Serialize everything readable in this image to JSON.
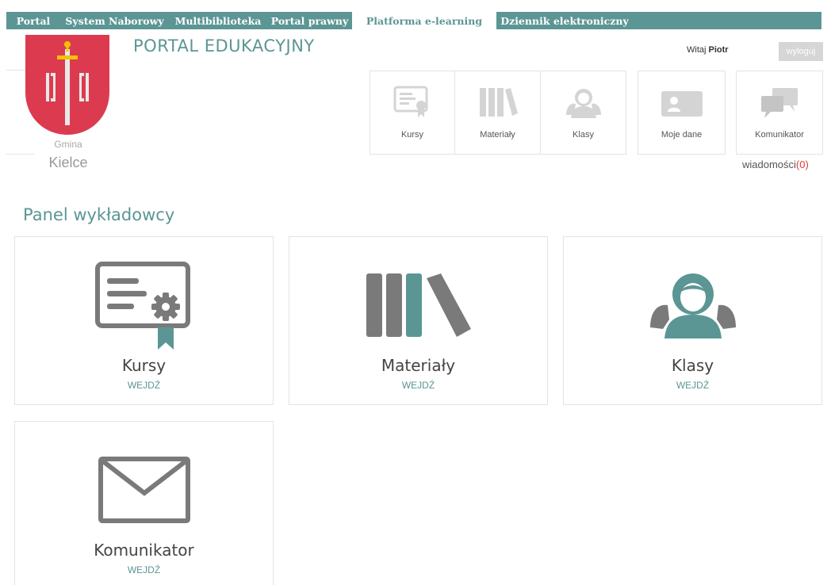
{
  "topnav": {
    "tabs": [
      {
        "label": "Portal"
      },
      {
        "label": "System Naborowy"
      },
      {
        "label": "Multibiblioteka"
      },
      {
        "label": "Portal prawny"
      },
      {
        "label": "Platforma e-learning",
        "active": true
      },
      {
        "label": "Dziennik elektroniczny"
      }
    ]
  },
  "header": {
    "portal_title": "PORTAL EDUKACYJNY",
    "logo_line1": "Gmina",
    "logo_line2": "Kielce",
    "welcome_prefix": "Witaj",
    "user_name": "Piotr",
    "logout_label": "wyloguj"
  },
  "shortcuts": [
    {
      "label": "Kursy",
      "icon": "certificate-icon"
    },
    {
      "label": "Materiały",
      "icon": "books-icon"
    },
    {
      "label": "Klasy",
      "icon": "people-icon"
    },
    {
      "label": "Moje dane",
      "icon": "id-card-icon"
    },
    {
      "label": "Komunikator",
      "icon": "chat-icon"
    }
  ],
  "messages": {
    "label": "wiadomości",
    "count": "(0)"
  },
  "panel": {
    "title": "Panel wykładowcy",
    "enter_label": "WEJDŹ",
    "tiles": [
      {
        "label": "Kursy",
        "icon": "certificate-icon"
      },
      {
        "label": "Materiały",
        "icon": "books-icon"
      },
      {
        "label": "Klasy",
        "icon": "people-icon"
      },
      {
        "label": "Komunikator",
        "icon": "envelope-icon"
      }
    ]
  },
  "colors": {
    "accent": "#5b9694",
    "icon_gray": "#7a7a7a",
    "light_icon": "#d4d4d4",
    "badge_red": "#e03a3a",
    "shield_red": "#dc3b4f"
  }
}
